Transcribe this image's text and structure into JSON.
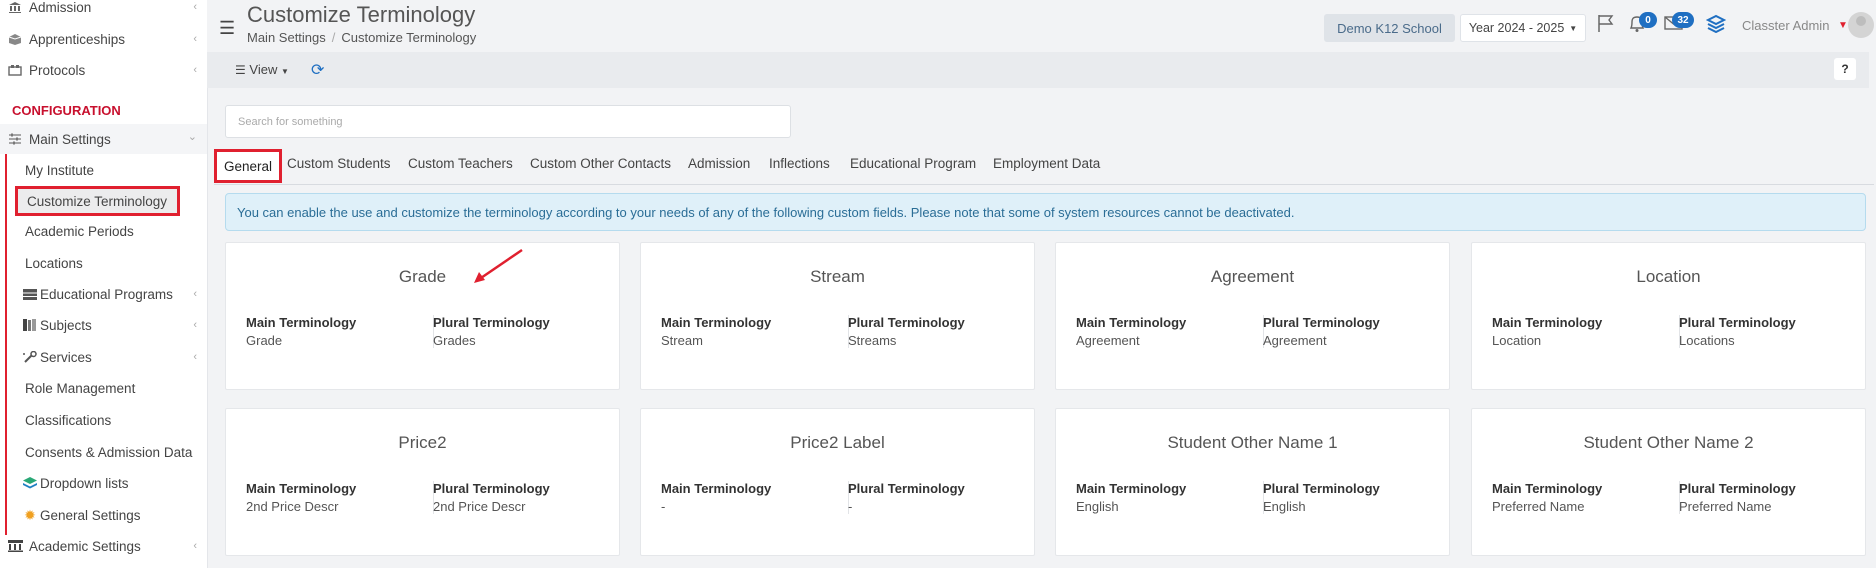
{
  "sidebar": {
    "items": [
      {
        "label": "Admission",
        "icon": "bank-icon",
        "chevron": "‹"
      },
      {
        "label": "Apprenticeships",
        "icon": "box-icon",
        "chevron": "‹"
      },
      {
        "label": "Protocols",
        "icon": "protocol-icon",
        "chevron": "‹"
      }
    ],
    "section_header": "CONFIGURATION",
    "main_settings": {
      "label": "Main Settings",
      "icon": "sliders-icon",
      "chevron": "⌄"
    },
    "sub_items": [
      {
        "label": "My Institute"
      },
      {
        "label": "Customize Terminology"
      },
      {
        "label": "Academic Periods"
      },
      {
        "label": "Locations"
      },
      {
        "label": "Educational Programs",
        "icon": "table-icon",
        "chevron": "‹"
      },
      {
        "label": "Subjects",
        "icon": "books-icon",
        "chevron": "‹"
      },
      {
        "label": "Services",
        "icon": "services-icon",
        "chevron": "‹"
      },
      {
        "label": "Role Management"
      },
      {
        "label": "Classifications"
      },
      {
        "label": "Consents & Admission Data"
      },
      {
        "label": "Dropdown lists",
        "icon": "layers-icon"
      },
      {
        "label": "General Settings",
        "icon": "cog-icon"
      }
    ],
    "academic_settings": {
      "label": "Academic Settings",
      "icon": "academic-icon",
      "chevron": "‹"
    }
  },
  "header": {
    "title": "Customize Terminology",
    "breadcrumb": [
      "Main Settings",
      "Customize Terminology"
    ],
    "school": "Demo K12 School",
    "year": "Year 2024 - 2025",
    "notifications_count": "0",
    "messages_count": "32",
    "user": "Classter Admin"
  },
  "toolbar": {
    "view_label": "View",
    "help_label": "?"
  },
  "search": {
    "placeholder": "Search for something"
  },
  "tabs": [
    {
      "label": "General",
      "active": true
    },
    {
      "label": "Custom Students"
    },
    {
      "label": "Custom Teachers"
    },
    {
      "label": "Custom Other Contacts"
    },
    {
      "label": "Admission"
    },
    {
      "label": "Inflections"
    },
    {
      "label": "Educational Program"
    },
    {
      "label": "Employment Data"
    }
  ],
  "info_text": "You can enable the use and customize the terminology according to your needs of any of the following custom fields. Please note that some of system resources cannot be deactivated.",
  "labels": {
    "main": "Main Terminology",
    "plural": "Plural Terminology"
  },
  "cards": [
    {
      "title": "Grade",
      "main": "Grade",
      "plural": "Grades"
    },
    {
      "title": "Stream",
      "main": "Stream",
      "plural": "Streams"
    },
    {
      "title": "Agreement",
      "main": "Agreement",
      "plural": "Agreement"
    },
    {
      "title": "Location",
      "main": "Location",
      "plural": "Locations"
    },
    {
      "title": "Price2",
      "main": "2nd Price Descr",
      "plural": "2nd Price Descr"
    },
    {
      "title": "Price2 Label",
      "main": "-",
      "plural": "-"
    },
    {
      "title": "Student Other Name 1",
      "main": "English",
      "plural": "English"
    },
    {
      "title": "Student Other Name 2",
      "main": "Preferred Name",
      "plural": "Preferred Name"
    }
  ],
  "colors": {
    "accent": "#1f6fc2",
    "highlight": "#e0202f",
    "config_header": "#c8102e"
  }
}
